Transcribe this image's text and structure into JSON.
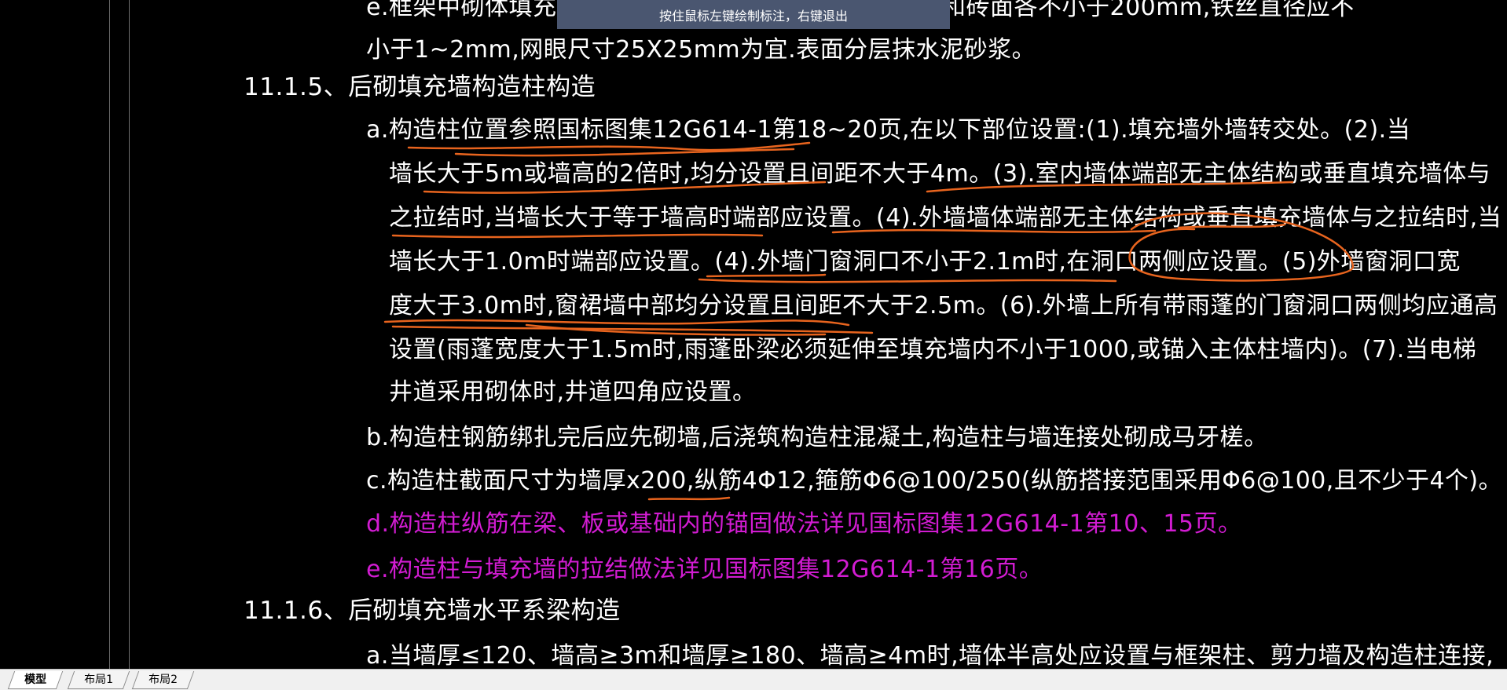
{
  "hint_bar": {
    "text": "按住鼠标左键绘制标注，右键退出"
  },
  "drawing": {
    "lines": [
      {
        "id": "l0",
        "text": "e.框架中砌体填充墙与",
        "color": "white"
      },
      {
        "id": "l0b",
        "text": "面层和砖面各不小于200mm,铁丝直径应不",
        "color": "white"
      },
      {
        "id": "l1",
        "text": "小于1~2mm,网眼尺寸25X25mm为宜.表面分层抹水泥砂浆。",
        "color": "white"
      },
      {
        "id": "l2",
        "text": "11.1.5、后砌填充墙构造柱构造",
        "color": "white"
      },
      {
        "id": "l3",
        "text": "a.构造柱位置参照国标图集12G614-1第18~20页,在以下部位设置:(1).填充墙外墙转交处。(2).当",
        "color": "white"
      },
      {
        "id": "l4",
        "text": "墙长大于5m或墙高的2倍时,均分设置且间距不大于4m。(3).室内墙体端部无主体结构或垂直填充墙体与",
        "color": "white"
      },
      {
        "id": "l5",
        "text": "之拉结时,当墙长大于等于墙高时端部应设置。(4).外墙墙体端部无主体结构或垂直填充墙体与之拉结时,当",
        "color": "white"
      },
      {
        "id": "l6",
        "text": "墙长大于1.0m时端部应设置。(4).外墙门窗洞口不小于2.1m时,在洞口两侧应设置。(5)外墙窗洞口宽",
        "color": "white"
      },
      {
        "id": "l7",
        "text": "度大于3.0m时,窗裙墙中部均分设置且间距不大于2.5m。(6).外墙上所有带雨蓬的门窗洞口两侧均应通高",
        "color": "white"
      },
      {
        "id": "l8",
        "text": "设置(雨蓬宽度大于1.5m时,雨蓬卧梁必须延伸至填充墙内不小于1000,或锚入主体柱墙内)。(7).当电梯",
        "color": "white"
      },
      {
        "id": "l9",
        "text": "井道采用砌体时,井道四角应设置。",
        "color": "white"
      },
      {
        "id": "l10",
        "text": "b.构造柱钢筋绑扎完后应先砌墙,后浇筑构造柱混凝土,构造柱与墙连接处砌成马牙槎。",
        "color": "white"
      },
      {
        "id": "l11",
        "text": "c.构造柱截面尺寸为墙厚x200,纵筋4Φ12,箍筋Φ6@100/250(纵筋搭接范围采用Φ6@100,且不少于4个)。",
        "color": "white"
      },
      {
        "id": "l12",
        "text": "d.构造柱纵筋在梁、板或基础内的锚固做法详见国标图集12G614-1第10、15页。",
        "color": "magenta"
      },
      {
        "id": "l13",
        "text": "e.构造柱与填充墙的拉结做法详见国标图集12G614-1第16页。",
        "color": "magenta"
      },
      {
        "id": "l14",
        "text": "11.1.6、后砌填充墙水平系梁构造",
        "color": "white"
      },
      {
        "id": "l15",
        "text": "a.当墙厚≤120、墙高≥3m和墙厚≥180、墙高≥4m时,墙体半高处应设置与框架柱、剪力墙及构造柱连接,",
        "color": "white"
      }
    ],
    "annotation_color": "#e8641e",
    "text_color_magenta": "#d21cd2"
  },
  "tabs": [
    {
      "label": "模型",
      "active": true
    },
    {
      "label": "布局1",
      "active": false
    },
    {
      "label": "布局2",
      "active": false
    }
  ]
}
